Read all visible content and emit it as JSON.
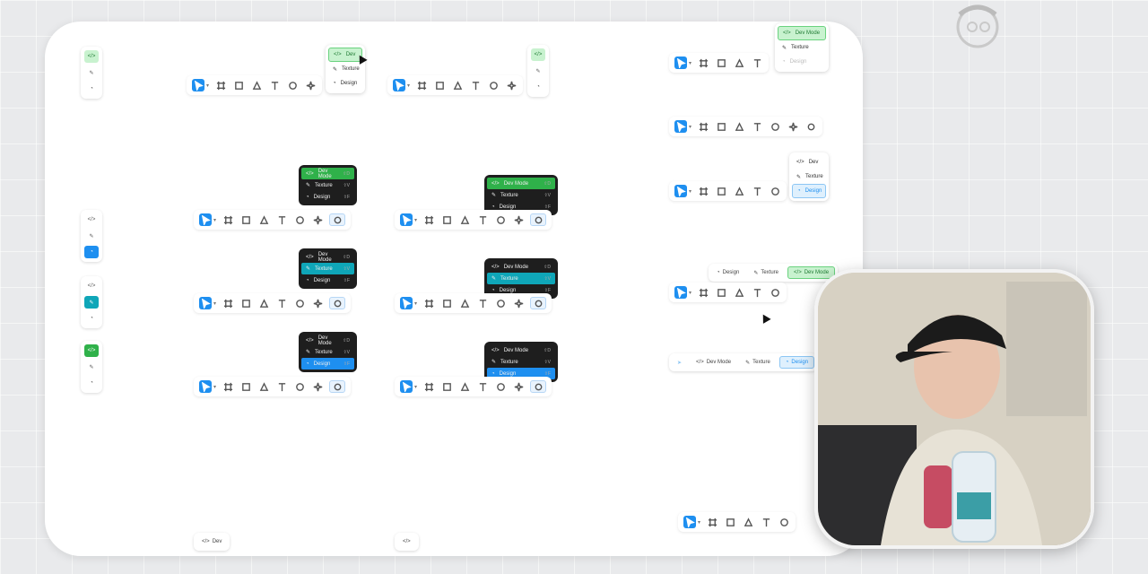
{
  "menu": {
    "dev_mode": "Dev Mode",
    "dev": "Dev",
    "texture": "Texture",
    "design": "Design",
    "sc_dev": "⇧D",
    "sc_texture": "⇧V",
    "sc_design": "⇧F"
  },
  "colors": {
    "dev_mode_green": "#2fb14a",
    "texture_teal": "#0fa6b8",
    "design_blue": "#1e8ff0",
    "dark_menu": "#1e1e1e"
  },
  "icons": [
    "move-icon",
    "frame-icon",
    "rectangle-icon",
    "pen-icon",
    "text-icon",
    "comment-icon",
    "actions-icon",
    "mode-icon"
  ],
  "webcam": {
    "description": "presenter video overlay"
  }
}
